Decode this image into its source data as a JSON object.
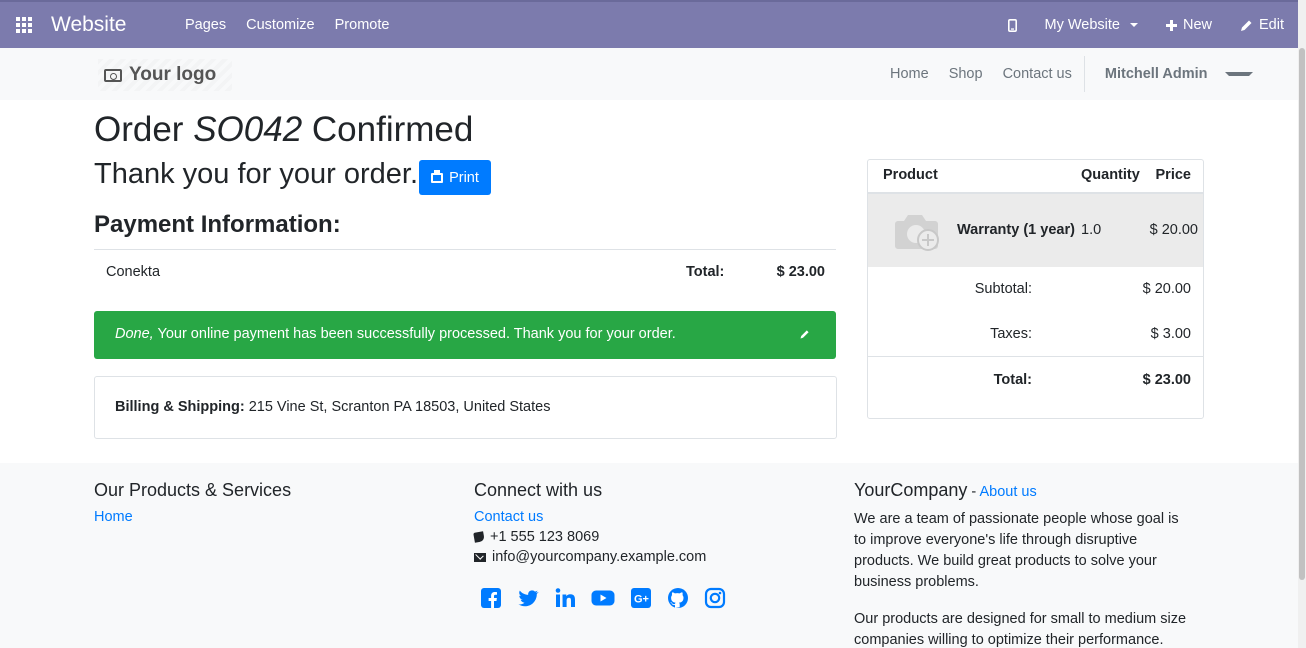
{
  "topbar": {
    "brand": "Website",
    "menu": [
      "Pages",
      "Customize",
      "Promote"
    ],
    "site_selector": "My Website",
    "new_label": "New",
    "edit_label": "Edit"
  },
  "header": {
    "logo_text": "Your logo",
    "nav": [
      "Home",
      "Shop",
      "Contact us"
    ],
    "user": "Mitchell Admin"
  },
  "order": {
    "title_prefix": "Order",
    "title_ref": "SO042",
    "title_suffix": "Confirmed",
    "thanks": "Thank you for your order.",
    "print_label": "Print",
    "payment_heading": "Payment Information:",
    "payment_method": "Conekta",
    "total_label": "Total:",
    "total_value": "$ 23.00",
    "alert_status": "Done,",
    "alert_message": "Your online payment has been successfully processed. Thank you for your order.",
    "billing_label": "Billing & Shipping:",
    "billing_address": "215 Vine St, Scranton PA 18503, United States"
  },
  "cart": {
    "headers": {
      "product": "Product",
      "quantity": "Quantity",
      "price": "Price"
    },
    "line": {
      "name": "Warranty (1 year)",
      "qty": "1.0",
      "price": "$ 20.00"
    },
    "subtotal_label": "Subtotal:",
    "subtotal_value": "$ 20.00",
    "taxes_label": "Taxes:",
    "taxes_value": "$ 3.00",
    "total_label": "Total:",
    "total_value": "$ 23.00"
  },
  "footer": {
    "col1_title": "Our Products & Services",
    "col1_link": "Home",
    "col2_title": "Connect with us",
    "col2_link": "Contact us",
    "phone": "+1 555 123 8069",
    "email": "info@yourcompany.example.com",
    "social_icons": [
      "facebook-icon",
      "twitter-icon",
      "linkedin-icon",
      "youtube-icon",
      "google-plus-icon",
      "github-icon",
      "instagram-icon"
    ],
    "col3_title": "YourCompany",
    "col3_sep": " - ",
    "col3_link": "About us",
    "col3_p1": "We are a team of passionate people whose goal is to improve everyone's life through disruptive products. We build great products to solve your business problems.",
    "col3_p2": "Our products are designed for small to medium size companies willing to optimize their performance."
  },
  "colors": {
    "topbar": "#7c7bad",
    "primary": "#007bff",
    "success": "#28a745"
  }
}
